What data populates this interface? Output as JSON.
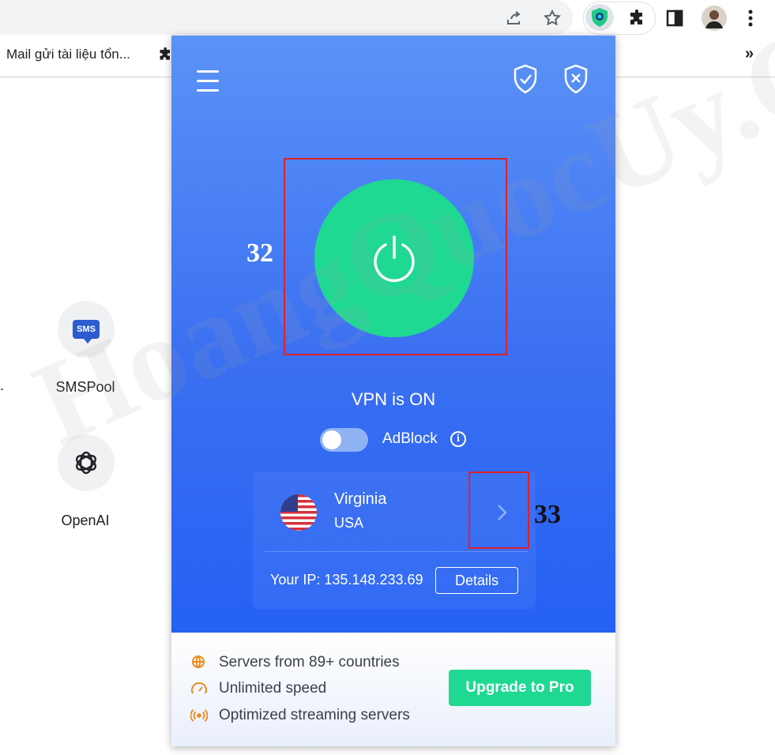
{
  "bookmarks": {
    "first": "Mail gửi tài liệu tổn...",
    "more": "»"
  },
  "tiles": [
    {
      "label": "SMSPool",
      "badge": "SMS"
    },
    {
      "label": "OpenAI"
    }
  ],
  "left_fragment": ".",
  "watermark": "HoangQuocUy.Com",
  "vpn": {
    "status": "VPN is ON",
    "adblock_label": "AdBlock",
    "adblock_on": false,
    "info": "i",
    "location": {
      "city": "Virginia",
      "country": "USA"
    },
    "ip_label": "Your IP: 135.148.233.69",
    "details_label": "Details"
  },
  "features": [
    {
      "icon": "globe-pin-icon",
      "text": "Servers from 89+ countries"
    },
    {
      "icon": "speedometer-icon",
      "text": "Unlimited speed"
    },
    {
      "icon": "broadcast-icon",
      "text": "Optimized streaming servers"
    }
  ],
  "upgrade_label": "Upgrade to Pro",
  "annotations": {
    "power": "32",
    "location": "33"
  },
  "colors": {
    "accent_green": "#1fd892",
    "vpn_blue": "#2561f4",
    "annotation_red": "#e0202a",
    "feature_orange": "#f08a1c"
  }
}
